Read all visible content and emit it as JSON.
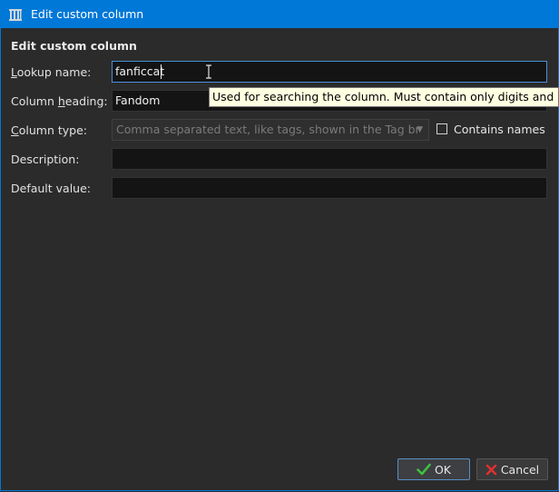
{
  "window": {
    "title": "Edit custom column",
    "icon": "library-icon",
    "accent_color": "#0078d7"
  },
  "section_title": "Edit custom column",
  "form": {
    "lookup_name": {
      "label_pre": "",
      "label_key": "L",
      "label_post": "ookup name:",
      "value": "fanficcat"
    },
    "column_heading": {
      "label_pre": "Column ",
      "label_key": "h",
      "label_post": "eading:",
      "value": "Fandom"
    },
    "column_type": {
      "label_pre": "",
      "label_key": "C",
      "label_post": "olumn type:",
      "selected": "Comma separated text, like tags, shown in the Tag br"
    },
    "contains_names": {
      "label": "Contains names",
      "checked": false
    },
    "description": {
      "label": "Description:",
      "value": ""
    },
    "default_value": {
      "label": "Default value:",
      "value": ""
    }
  },
  "tooltip": "Used for searching the column. Must contain only digits and lo",
  "buttons": {
    "ok": "OK",
    "cancel": "Cancel"
  }
}
